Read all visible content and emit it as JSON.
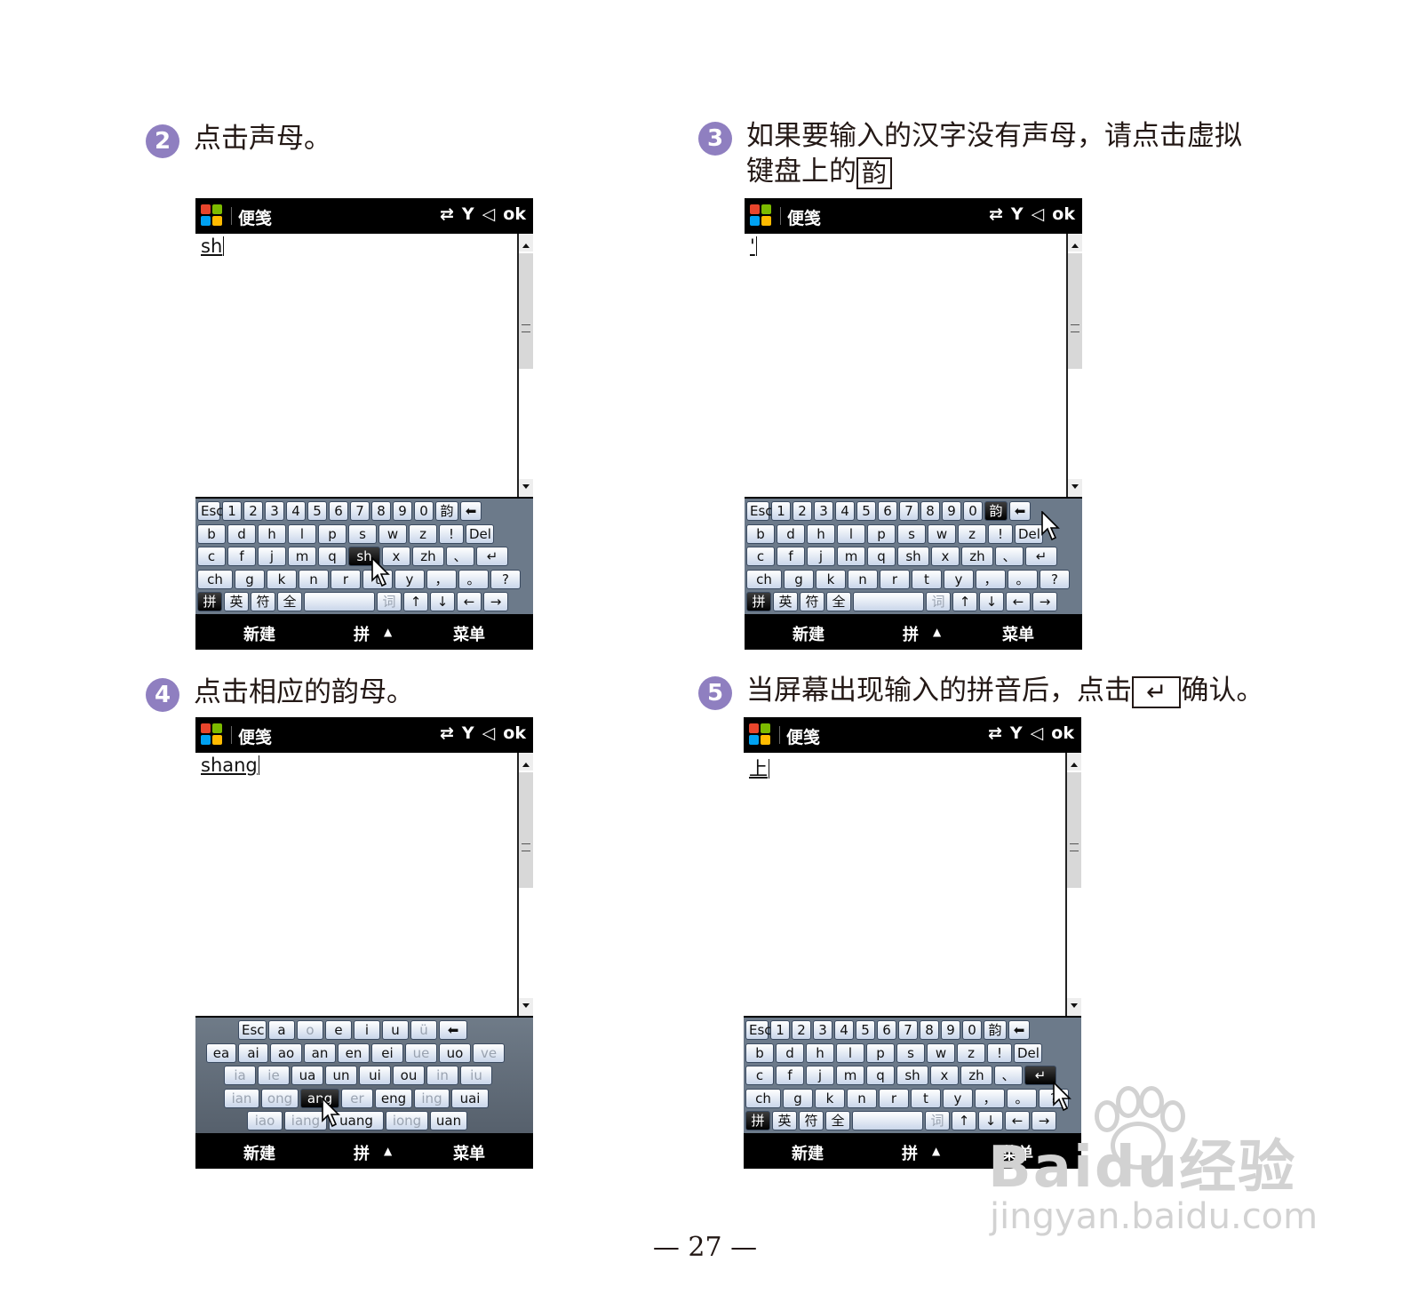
{
  "steps": [
    {
      "num": "2",
      "text": "点击声母。"
    },
    {
      "num": "3",
      "text_line1": "如果要输入的汉字没有声母，请点击虚拟",
      "text_line2": "键盘上的",
      "key": "韵"
    },
    {
      "num": "4",
      "text": "点击相应的韵母。"
    },
    {
      "num": "5",
      "text_before": "当屏幕出现输入的拼音后，点击",
      "key": "↵",
      "text_after": "确认。"
    }
  ],
  "device": {
    "app_title": "便笺",
    "ok_label": "ok",
    "status_icons": [
      "sync-icon",
      "signal-icon",
      "volume-icon"
    ],
    "status_glyphs": [
      "⇄",
      "Y",
      "◁"
    ],
    "bottom_left": "新建",
    "bottom_mid": "拼",
    "bottom_mid_arrow": "▲",
    "bottom_right": "菜单"
  },
  "screens": [
    {
      "typed": "sh"
    },
    {
      "typed": "'"
    },
    {
      "typed": "shang"
    },
    {
      "typed": "上"
    }
  ],
  "keyboard_consonant": {
    "row1": [
      "Esc",
      "1",
      "2",
      "3",
      "4",
      "5",
      "6",
      "7",
      "8",
      "9",
      "0",
      "韵",
      "⬅"
    ],
    "row2": [
      "b",
      "d",
      "h",
      "l",
      "p",
      "s",
      "w",
      "z",
      "!",
      "Del"
    ],
    "row3": [
      "c",
      "f",
      "j",
      "m",
      "q",
      "sh",
      "x",
      "zh",
      "、",
      "↵"
    ],
    "row4": [
      "ch",
      "g",
      "k",
      "n",
      "r",
      "t",
      "y",
      "，",
      "。",
      "?"
    ],
    "row5": [
      "拼",
      "英",
      "符",
      "全",
      "",
      "词",
      "↑",
      "↓",
      "←",
      "→"
    ]
  },
  "keyboard_vowel": {
    "row1": [
      "Esc",
      "a",
      "o",
      "e",
      "i",
      "u",
      "ü",
      "⬅"
    ],
    "row2": [
      "ea",
      "ai",
      "ao",
      "an",
      "en",
      "ei",
      "ue",
      "uo",
      "ve"
    ],
    "row3": [
      "ia",
      "ie",
      "ua",
      "un",
      "ui",
      "ou",
      "in",
      "iu"
    ],
    "row4": [
      "ian",
      "ong",
      "ang",
      "er",
      "eng",
      "ing",
      "uai"
    ],
    "row5": [
      "iao",
      "iang",
      "uang",
      "iong",
      "uan"
    ]
  },
  "page_number": "— 27 —",
  "watermark": {
    "big": "Baidu经验",
    "small": "jingyan.baidu.com"
  },
  "colors": {
    "step_badge": "#8f7fc0",
    "device_bar": "#000000",
    "key_highlight": "#000000"
  }
}
